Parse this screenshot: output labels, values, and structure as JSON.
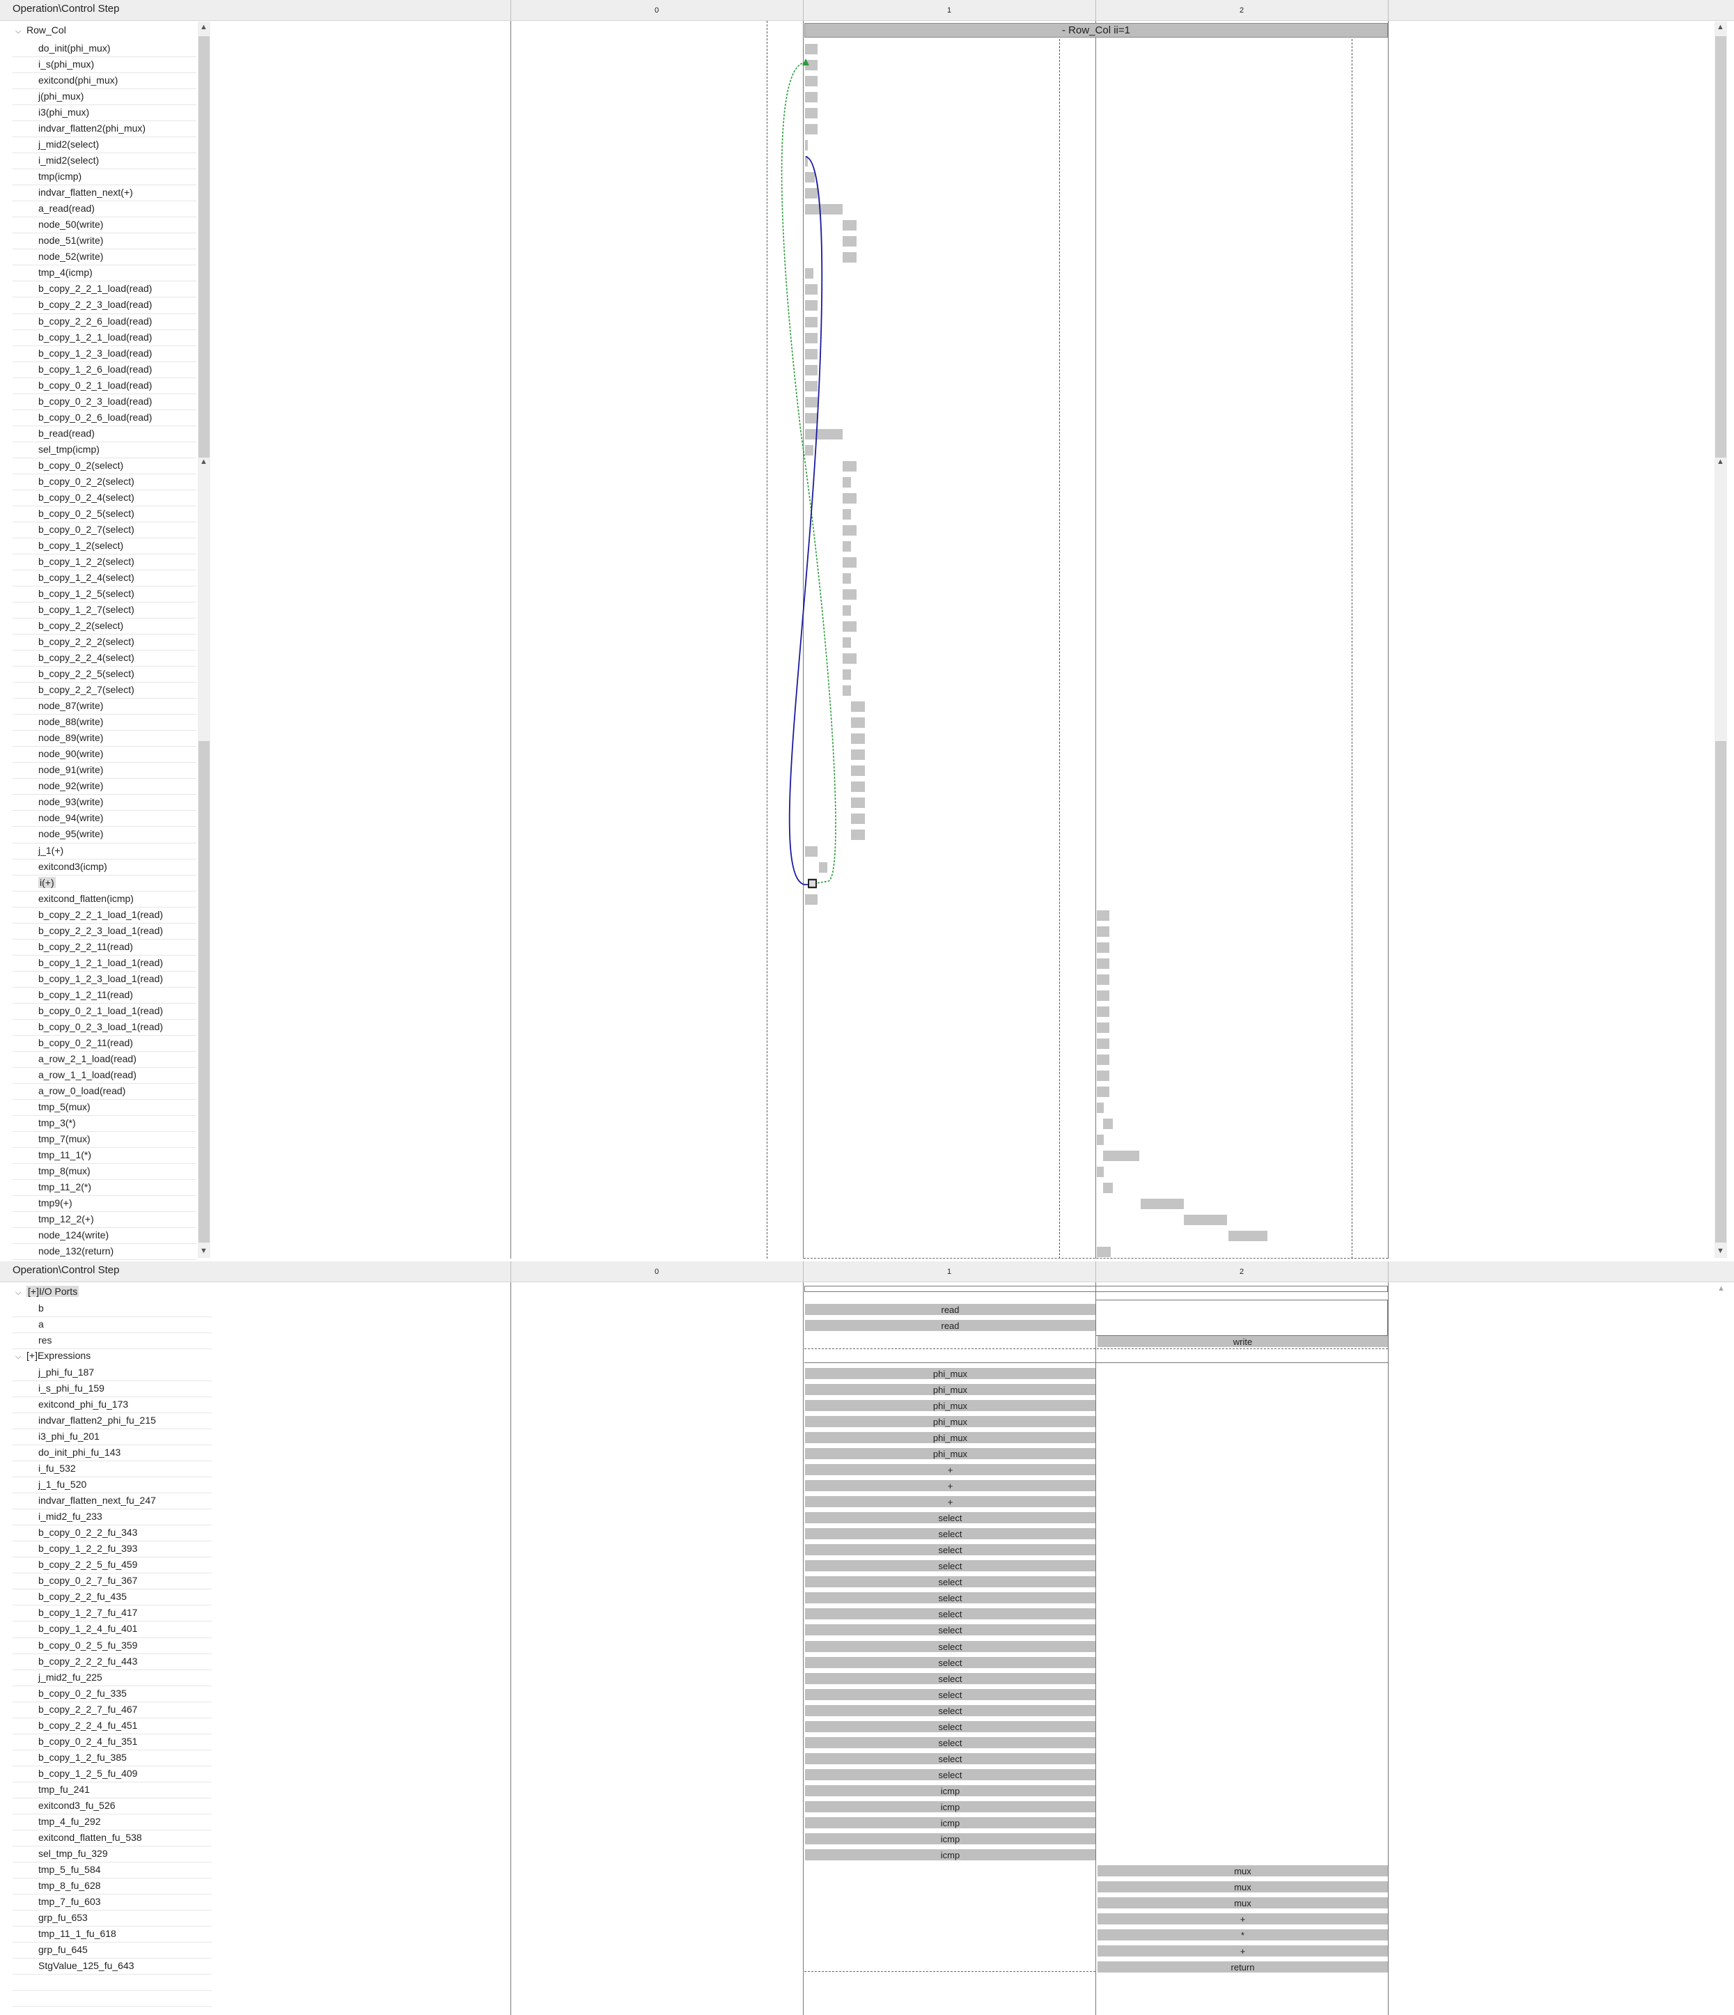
{
  "header": {
    "title": "Operation\\Control Step",
    "steps": [
      "0",
      "1",
      "2"
    ]
  },
  "loop_label": "- Row_Col   ii=1",
  "top_group": "Row_Col",
  "operations": [
    "do_init(phi_mux)",
    "i_s(phi_mux)",
    "exitcond(phi_mux)",
    "j(phi_mux)",
    "i3(phi_mux)",
    "indvar_flatten2(phi_mux)",
    "j_mid2(select)",
    "i_mid2(select)",
    "tmp(icmp)",
    "indvar_flatten_next(+)",
    "a_read(read)",
    "node_50(write)",
    "node_51(write)",
    "node_52(write)",
    "tmp_4(icmp)",
    "b_copy_2_2_1_load(read)",
    "b_copy_2_2_3_load(read)",
    "b_copy_2_2_6_load(read)",
    "b_copy_1_2_1_load(read)",
    "b_copy_1_2_3_load(read)",
    "b_copy_1_2_6_load(read)",
    "b_copy_0_2_1_load(read)",
    "b_copy_0_2_3_load(read)",
    "b_copy_0_2_6_load(read)",
    "b_read(read)",
    "sel_tmp(icmp)",
    "b_copy_0_2(select)",
    "b_copy_0_2_2(select)",
    "b_copy_0_2_4(select)",
    "b_copy_0_2_5(select)",
    "b_copy_0_2_7(select)",
    "b_copy_1_2(select)",
    "b_copy_1_2_2(select)",
    "b_copy_1_2_4(select)",
    "b_copy_1_2_5(select)",
    "b_copy_1_2_7(select)",
    "b_copy_2_2(select)",
    "b_copy_2_2_2(select)",
    "b_copy_2_2_4(select)",
    "b_copy_2_2_5(select)",
    "b_copy_2_2_7(select)",
    "node_87(write)",
    "node_88(write)",
    "node_89(write)",
    "node_90(write)",
    "node_91(write)",
    "node_92(write)",
    "node_93(write)",
    "node_94(write)",
    "node_95(write)",
    "j_1(+)",
    "exitcond3(icmp)",
    "i(+)",
    "exitcond_flatten(icmp)",
    "b_copy_2_2_1_load_1(read)",
    "b_copy_2_2_3_load_1(read)",
    "b_copy_2_2_11(read)",
    "b_copy_1_2_1_load_1(read)",
    "b_copy_1_2_3_load_1(read)",
    "b_copy_1_2_11(read)",
    "b_copy_0_2_1_load_1(read)",
    "b_copy_0_2_3_load_1(read)",
    "b_copy_0_2_11(read)",
    "a_row_2_1_load(read)",
    "a_row_1_1_load(read)",
    "a_row_0_load(read)",
    "tmp_5(mux)",
    "tmp_3(*)",
    "tmp_7(mux)",
    "tmp_11_1(*)",
    "tmp_8(mux)",
    "tmp_11_2(*)",
    "tmp9(+)",
    "tmp_12_2(+)",
    "node_124(write)",
    "node_132(return)"
  ],
  "selected_operation": "i(+)",
  "io_group": "[+]I/O Ports",
  "io_ports": [
    {
      "name": "b",
      "op": "read"
    },
    {
      "name": "a",
      "op": "read"
    },
    {
      "name": "res",
      "op": "write"
    }
  ],
  "expr_group": "[+]Expressions",
  "expressions": [
    {
      "name": "j_phi_fu_187",
      "op": "phi_mux"
    },
    {
      "name": "i_s_phi_fu_159",
      "op": "phi_mux"
    },
    {
      "name": "exitcond_phi_fu_173",
      "op": "phi_mux"
    },
    {
      "name": "indvar_flatten2_phi_fu_215",
      "op": "phi_mux"
    },
    {
      "name": "i3_phi_fu_201",
      "op": "phi_mux"
    },
    {
      "name": "do_init_phi_fu_143",
      "op": "phi_mux"
    },
    {
      "name": "i_fu_532",
      "op": "+"
    },
    {
      "name": "j_1_fu_520",
      "op": "+"
    },
    {
      "name": "indvar_flatten_next_fu_247",
      "op": "+"
    },
    {
      "name": "i_mid2_fu_233",
      "op": "select"
    },
    {
      "name": "b_copy_0_2_2_fu_343",
      "op": "select"
    },
    {
      "name": "b_copy_1_2_2_fu_393",
      "op": "select"
    },
    {
      "name": "b_copy_2_2_5_fu_459",
      "op": "select"
    },
    {
      "name": "b_copy_0_2_7_fu_367",
      "op": "select"
    },
    {
      "name": "b_copy_2_2_fu_435",
      "op": "select"
    },
    {
      "name": "b_copy_1_2_7_fu_417",
      "op": "select"
    },
    {
      "name": "b_copy_1_2_4_fu_401",
      "op": "select"
    },
    {
      "name": "b_copy_0_2_5_fu_359",
      "op": "select"
    },
    {
      "name": "b_copy_2_2_2_fu_443",
      "op": "select"
    },
    {
      "name": "j_mid2_fu_225",
      "op": "select"
    },
    {
      "name": "b_copy_0_2_fu_335",
      "op": "select"
    },
    {
      "name": "b_copy_2_2_7_fu_467",
      "op": "select"
    },
    {
      "name": "b_copy_2_2_4_fu_451",
      "op": "select"
    },
    {
      "name": "b_copy_0_2_4_fu_351",
      "op": "select"
    },
    {
      "name": "b_copy_1_2_fu_385",
      "op": "select"
    },
    {
      "name": "b_copy_1_2_5_fu_409",
      "op": "select"
    },
    {
      "name": "tmp_fu_241",
      "op": "icmp"
    },
    {
      "name": "exitcond3_fu_526",
      "op": "icmp"
    },
    {
      "name": "tmp_4_fu_292",
      "op": "icmp"
    },
    {
      "name": "exitcond_flatten_fu_538",
      "op": "icmp"
    },
    {
      "name": "sel_tmp_fu_329",
      "op": "icmp"
    },
    {
      "name": "tmp_5_fu_584",
      "op": "mux"
    },
    {
      "name": "tmp_8_fu_628",
      "op": "mux"
    },
    {
      "name": "tmp_7_fu_603",
      "op": "mux"
    },
    {
      "name": "grp_fu_653",
      "op": "+"
    },
    {
      "name": "tmp_11_1_fu_618",
      "op": "*"
    },
    {
      "name": "grp_fu_645",
      "op": "+"
    },
    {
      "name": "StgValue_125_fu_643",
      "op": "return"
    }
  ],
  "colors": {
    "bar": "#c4c4c4",
    "header": "#eeeeee",
    "blue_dep": "#1a1aa0",
    "green_dep": "#2e9b3c"
  }
}
